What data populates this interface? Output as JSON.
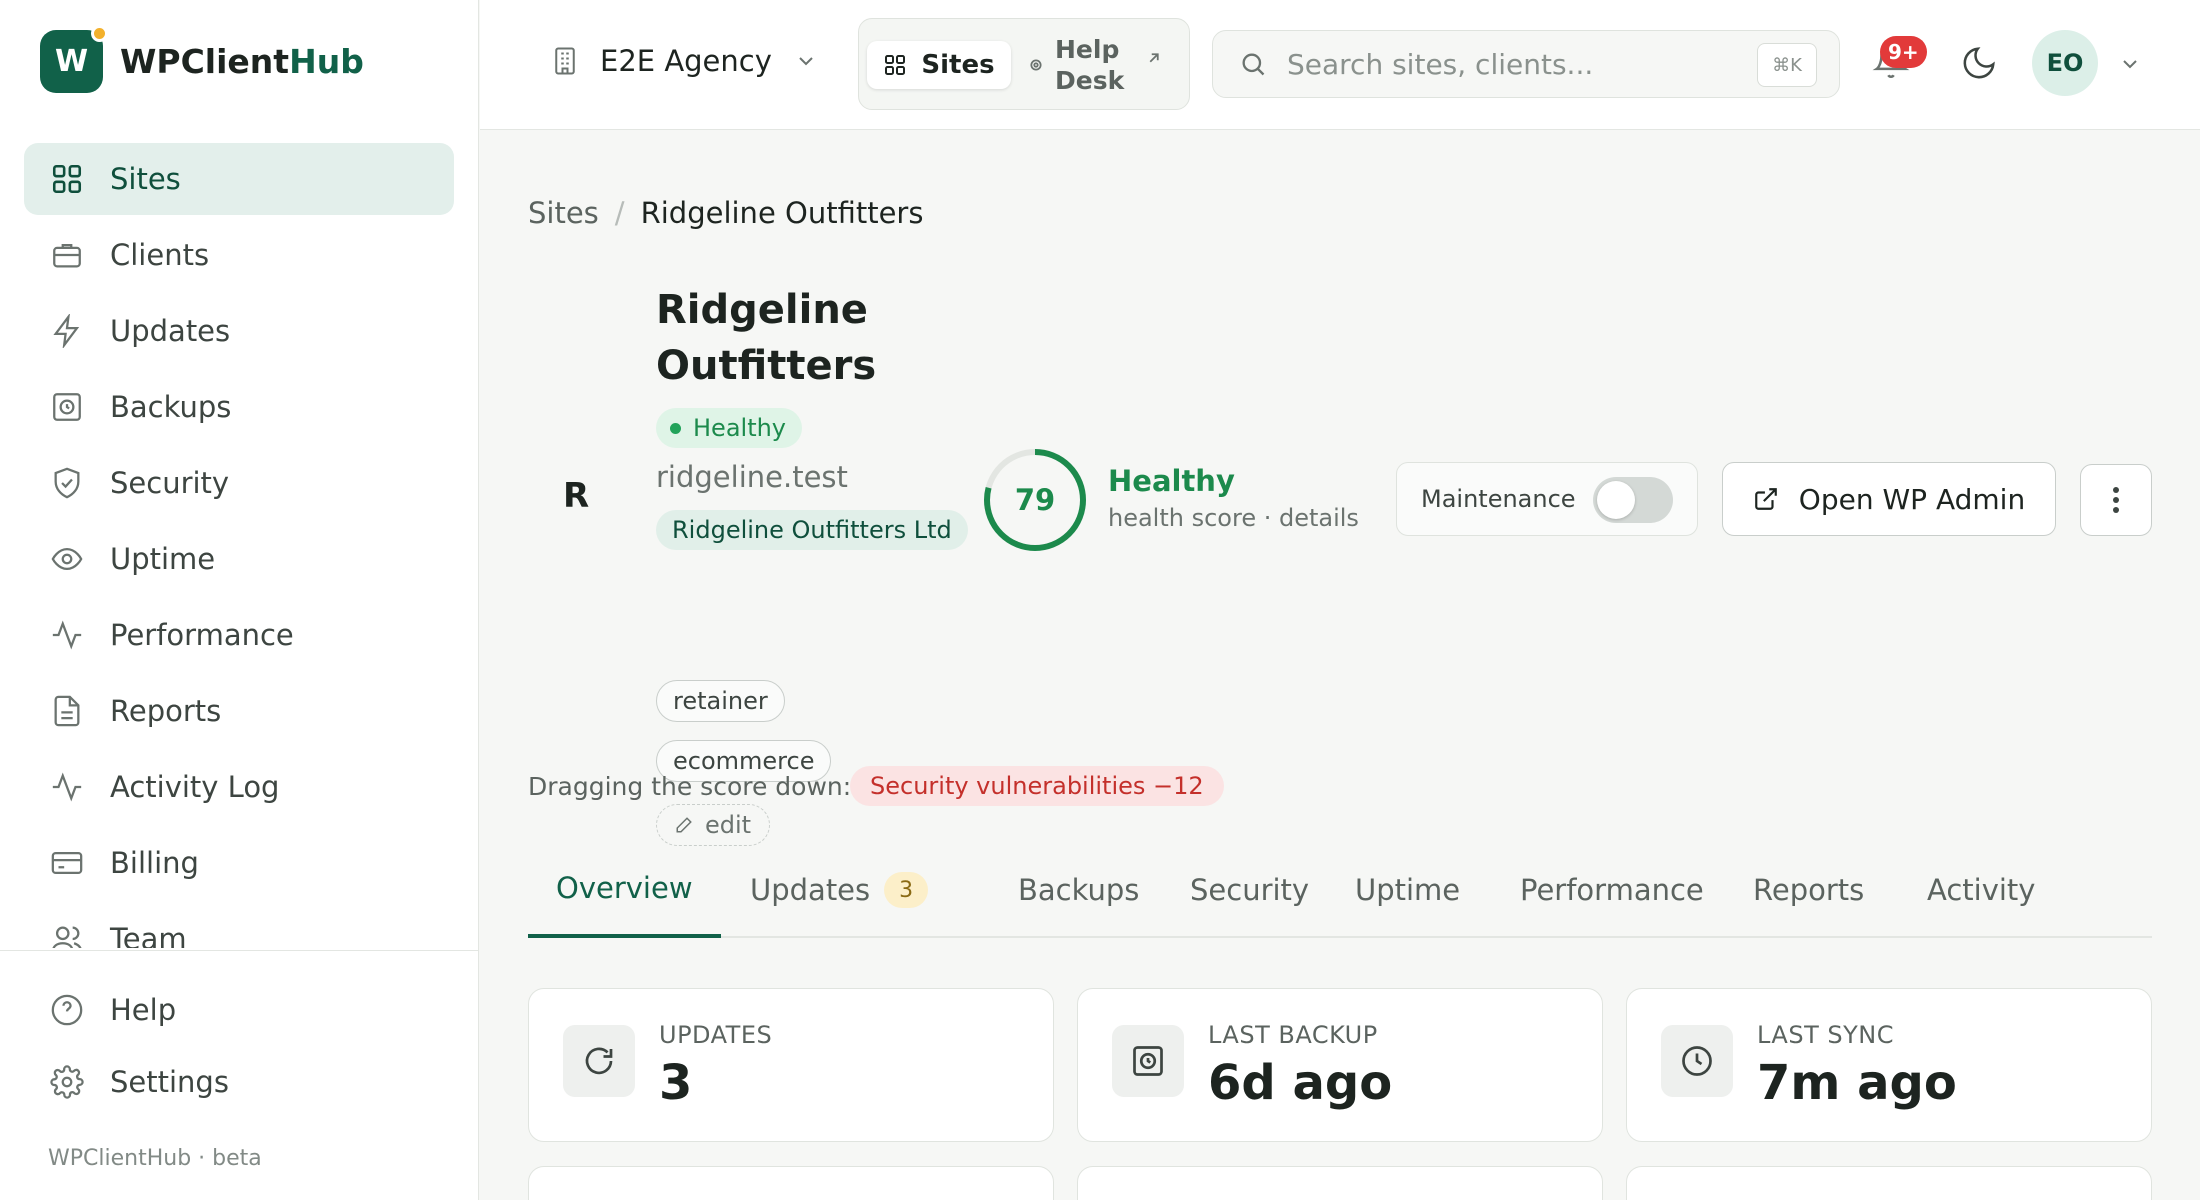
{
  "brand": {
    "logo_letter": "W",
    "name_part1": "WPClient",
    "name_part2": "Hub"
  },
  "sidebar": {
    "items": [
      {
        "label": "Sites",
        "icon": "grid-icon"
      },
      {
        "label": "Clients",
        "icon": "briefcase-icon"
      },
      {
        "label": "Updates",
        "icon": "bolt-icon"
      },
      {
        "label": "Backups",
        "icon": "backup-icon"
      },
      {
        "label": "Security",
        "icon": "shield-icon"
      },
      {
        "label": "Uptime",
        "icon": "eye-icon"
      },
      {
        "label": "Performance",
        "icon": "activity-icon"
      },
      {
        "label": "Reports",
        "icon": "document-icon"
      },
      {
        "label": "Activity Log",
        "icon": "activity-icon"
      },
      {
        "label": "Billing",
        "icon": "card-icon"
      },
      {
        "label": "Team",
        "icon": "users-icon"
      }
    ],
    "bottom": [
      {
        "label": "Help",
        "icon": "help-icon"
      },
      {
        "label": "Settings",
        "icon": "gear-icon"
      }
    ],
    "footer": "WPClientHub · beta"
  },
  "topbar": {
    "agency": "E2E Agency",
    "toggle_sites": "Sites",
    "toggle_help": "Help Desk",
    "search_placeholder": "Search sites, clients...",
    "search_shortcut": "⌘K",
    "notifications": "9+",
    "avatar_initials": "EO"
  },
  "breadcrumb": {
    "parent": "Sites",
    "separator": "/",
    "current": "Ridgeline Outfitters"
  },
  "site": {
    "initial": "R",
    "name": "Ridgeline Outfitters",
    "status": "Healthy",
    "domain": "ridgeline.test",
    "client": "Ridgeline Outfitters Ltd",
    "tags": [
      "retainer",
      "ecommerce"
    ],
    "edit_label": "edit"
  },
  "health": {
    "score": "79",
    "score_value": 79,
    "label": "Healthy",
    "sub": "health score · details"
  },
  "actions": {
    "maintenance_label": "Maintenance",
    "maintenance_on": false,
    "open_admin": "Open WP Admin"
  },
  "drag": {
    "label": "Dragging the score down:",
    "item": "Security vulnerabilities  −12"
  },
  "tabs": [
    {
      "label": "Overview",
      "active": true
    },
    {
      "label": "Updates",
      "count": "3"
    },
    {
      "label": "Backups"
    },
    {
      "label": "Security"
    },
    {
      "label": "Uptime"
    },
    {
      "label": "Performance"
    },
    {
      "label": "Reports"
    },
    {
      "label": "Activity"
    }
  ],
  "cards": [
    {
      "label": "UPDATES",
      "value": "3",
      "icon": "refresh-icon"
    },
    {
      "label": "LAST BACKUP",
      "value": "6d ago",
      "icon": "backup-icon"
    },
    {
      "label": "LAST SYNC",
      "value": "7m ago",
      "icon": "clock-icon"
    }
  ],
  "colors": {
    "brand": "#116149",
    "healthy": "#1c8a4c",
    "danger": "#c4302b",
    "warning_badge": "#fcefc9"
  }
}
